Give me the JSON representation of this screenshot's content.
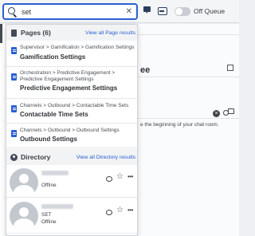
{
  "search": {
    "value": "set",
    "placeholder": "Search",
    "clear_icon": "close-icon",
    "search_icon": "search-icon"
  },
  "topbar": {
    "queue_label": "Off Queue",
    "chat_icon": "chat-icon",
    "inbox_icon": "inbox-icon"
  },
  "background": {
    "title_fragment": "ee",
    "chat_text": "e the beginning of your chat room."
  },
  "pages": {
    "header": "Pages (6)",
    "view_all": "View all Page results",
    "items": [
      {
        "crumb": "Supervisor > Gamification > Gamification Settings",
        "title": "Gamification Settings"
      },
      {
        "crumb": "Orchestration > Predictive Engagement > Predictive Engagement Settings",
        "title": "Predictive Engagement Settings"
      },
      {
        "crumb": "Channels > Outbound > Contactable Time Sets",
        "title": "Contactable Time Sets"
      },
      {
        "crumb": "Channels > Outbound > Outbound Settings",
        "title": "Outbound Settings"
      }
    ]
  },
  "directory": {
    "header": "Directory",
    "view_all": "View all Directory results",
    "items": [
      {
        "status": "Offline"
      },
      {
        "subtitle": "SET",
        "status": "Offline"
      }
    ]
  },
  "colors": {
    "accent": "#2a60d0",
    "header_bg": "#f2f3f5"
  }
}
